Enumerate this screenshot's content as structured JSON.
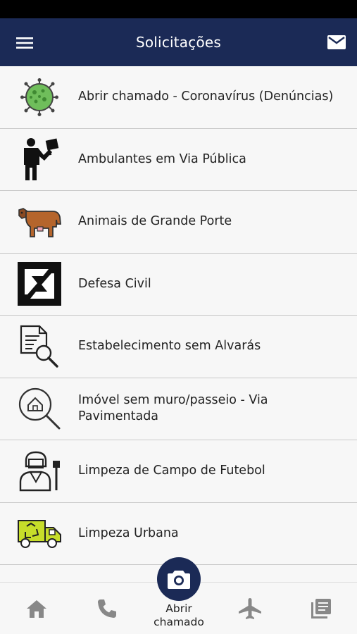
{
  "header": {
    "title": "Solicitações"
  },
  "icons": {
    "menu": "menu-icon",
    "mail": "mail-icon",
    "camera": "camera-icon",
    "home": "home-icon",
    "phone": "phone-icon",
    "plane": "airplane-icon",
    "library": "library-icon"
  },
  "colors": {
    "header_bg": "#1b2a56",
    "fab_bg": "#1b2a56",
    "nav_icon": "#888888"
  },
  "items": [
    {
      "label": "Abrir chamado - Coronavírus  (Denúncias)",
      "icon": "coronavirus-icon"
    },
    {
      "label": "Ambulantes em Via Pública",
      "icon": "street-vendor-icon"
    },
    {
      "label": "Animais de Grande Porte",
      "icon": "cow-icon"
    },
    {
      "label": "Defesa Civil",
      "icon": "civil-defense-icon"
    },
    {
      "label": "Estabelecimento sem Alvarás",
      "icon": "document-search-icon"
    },
    {
      "label": "Imóvel sem muro/passeio - Via Pavimentada",
      "icon": "house-search-icon"
    },
    {
      "label": "Limpeza de Campo de Futebol",
      "icon": "cleaner-icon"
    },
    {
      "label": "Limpeza Urbana",
      "icon": "garbage-truck-icon"
    }
  ],
  "bottom_nav": {
    "fab_label": "Abrir chamado"
  }
}
